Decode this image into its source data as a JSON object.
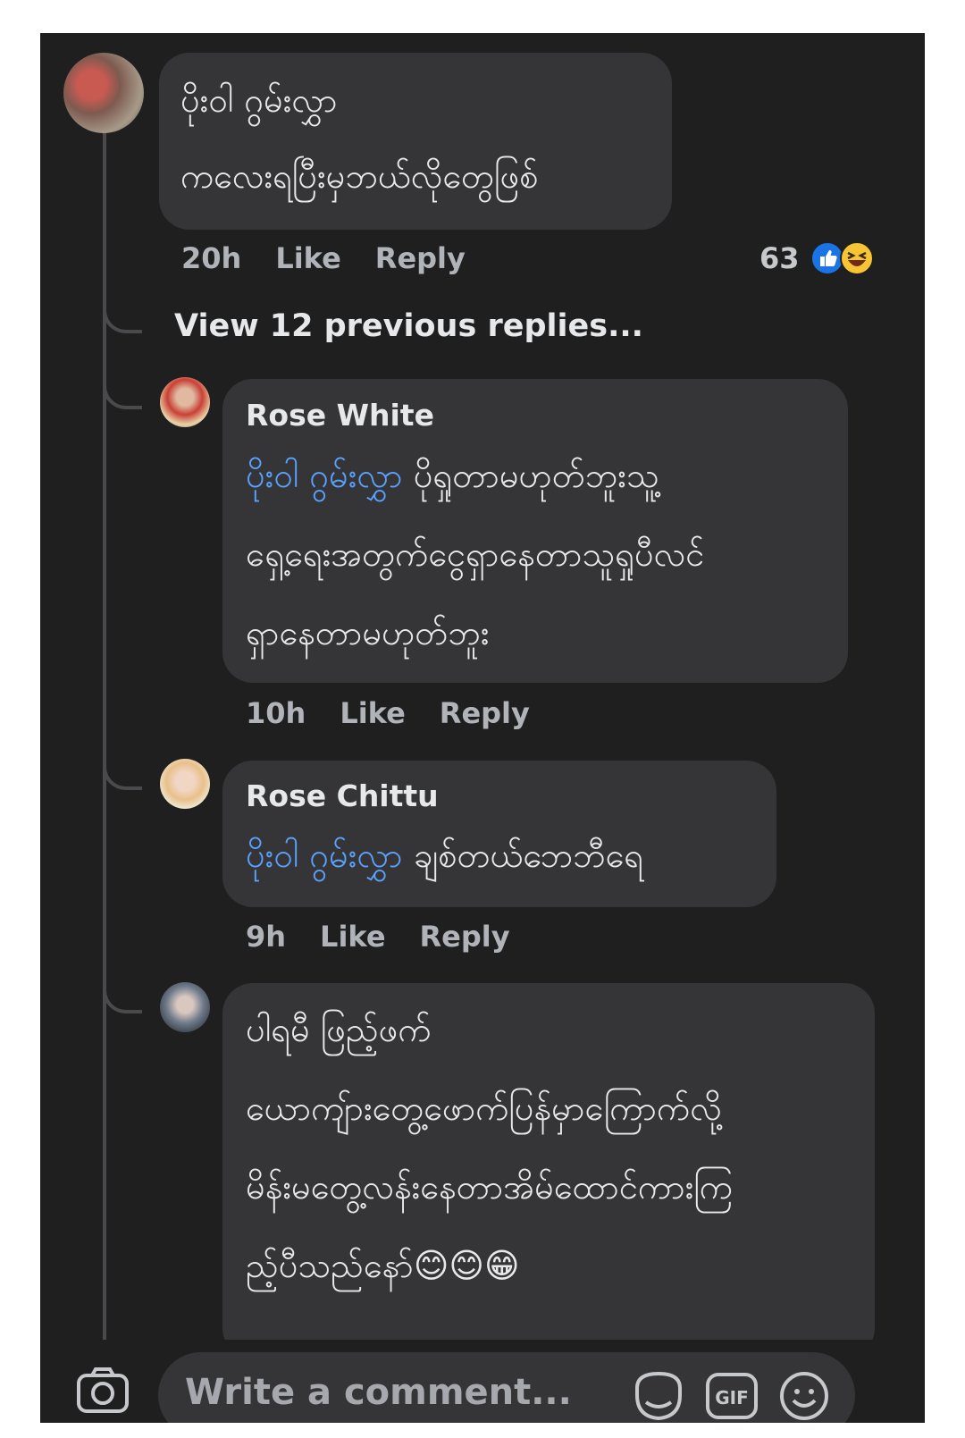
{
  "comments": {
    "top": {
      "line1": "ပိုးဝါ ဂွမ်းလွှာ",
      "line2": "ကလေးရပြီးမှဘယ်လိုတွေဖြစ်",
      "time": "20h",
      "like": "Like",
      "reply": "Reply",
      "reaction_count": "63"
    },
    "view_previous": "View 12 previous replies...",
    "replies": [
      {
        "author": "Rose White",
        "mention": "ပိုးဝါ ဂွမ်းလွှာ",
        "line1_rest": " ပိုရှုတာမဟုတ်ဘူးသူ့",
        "line2": "ရှေ့ရေးအတွက်ငွေရှာနေတာသူရှုပီလင်",
        "line3": "ရှာနေတာမဟုတ်ဘူး",
        "time": "10h",
        "like": "Like",
        "reply": "Reply"
      },
      {
        "author": "Rose Chittu",
        "mention": "ပိုးဝါ ဂွမ်းလွှာ",
        "line1_rest": " ချစ်တယ်ဘေဘီရေ",
        "time": "9h",
        "like": "Like",
        "reply": "Reply"
      },
      {
        "line1": "ပါရမီ ဖြည့်ဖက်",
        "line2": "ယောကျ်ားတွေ့ဖောက်ပြန်မှာကြောက်လို့",
        "line3": "မိန်းမတွေ့လန်းနေတာအိမ်ထောင်ကားကြ",
        "line4": "ည့်ပီသည်နော်",
        "emojis": "😊😊😁"
      }
    ]
  },
  "composer": {
    "placeholder": "Write a comment...",
    "gif_label": "GIF"
  },
  "colors": {
    "background": "#1f1f20",
    "bubble": "#353537",
    "mention": "#5aa2ff",
    "like_blue": "#1b74e4",
    "haha_yellow": "#f7c533"
  }
}
